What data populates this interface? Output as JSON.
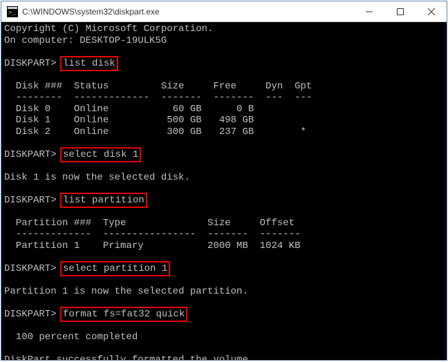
{
  "window": {
    "title": "C:\\WINDOWS\\system32\\diskpart.exe"
  },
  "terminal": {
    "copyright": "Copyright (C) Microsoft Corporation.",
    "computer_line": "On computer: DESKTOP-19ULK5G",
    "prompt": "DISKPART>",
    "cmd1": "list disk",
    "disk_header": "  Disk ###  Status         Size     Free     Dyn  Gpt",
    "disk_divider": "  --------  -------------  -------  -------  ---  ---",
    "disks": [
      "  Disk 0    Online           60 GB      0 B",
      "  Disk 1    Online          500 GB   498 GB",
      "  Disk 2    Online          300 GB   237 GB        *"
    ],
    "cmd2": "select disk 1",
    "msg_disk_selected": "Disk 1 is now the selected disk.",
    "cmd3": "list partition",
    "part_header": "  Partition ###  Type              Size     Offset",
    "part_divider": "  -------------  ----------------  -------  -------",
    "partitions": [
      "  Partition 1    Primary           2000 MB  1024 KB"
    ],
    "cmd4": "select partition 1",
    "msg_part_selected": "Partition 1 is now the selected partition.",
    "cmd5": "format fs=fat32 quick",
    "progress": "  100 percent completed",
    "msg_formatted": "DiskPart successfully formatted the volume."
  }
}
